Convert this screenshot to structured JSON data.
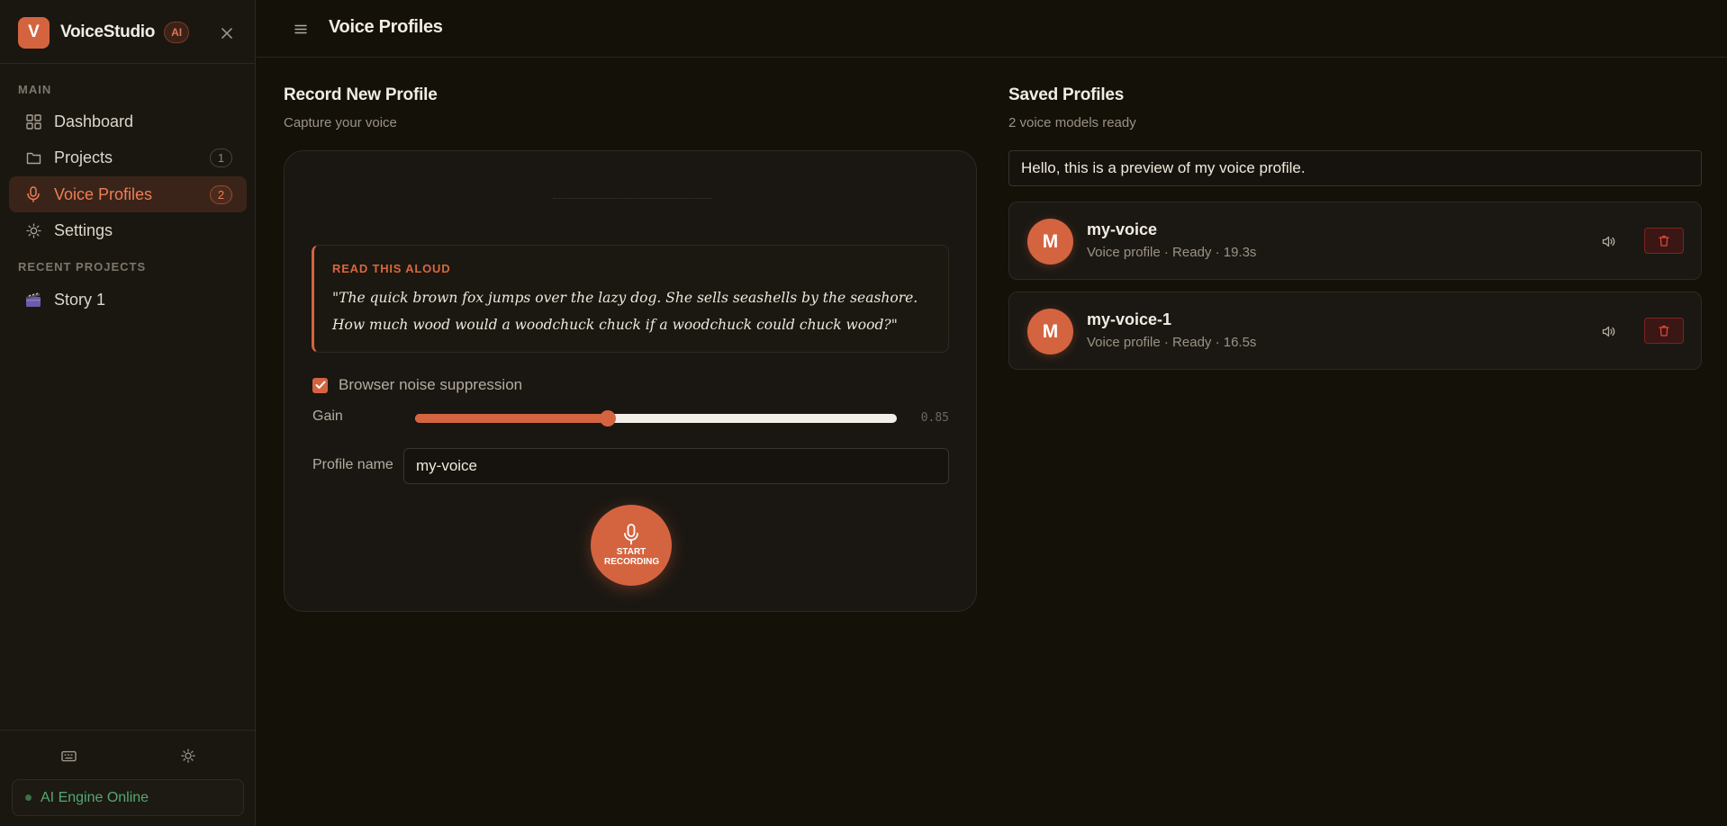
{
  "app": {
    "logo_letter": "V",
    "name": "VoiceStudio",
    "ai_badge": "AI",
    "accent_color": "#d4643f"
  },
  "sidebar": {
    "section_main": "MAIN",
    "items": [
      {
        "label": "Dashboard",
        "icon": "dashboard-grid-icon"
      },
      {
        "label": "Projects",
        "icon": "folder-icon",
        "count": "1"
      },
      {
        "label": "Voice Profiles",
        "icon": "microphone-icon",
        "count": "2",
        "active": true
      },
      {
        "label": "Settings",
        "icon": "sun-gear-icon"
      }
    ],
    "section_recent": "RECENT PROJECTS",
    "recent": [
      {
        "label": "Story 1",
        "icon": "clapperboard-icon"
      }
    ],
    "footer_icons": [
      "keyboard-icon",
      "theme-sun-icon"
    ],
    "engine_status": "AI Engine Online"
  },
  "header": {
    "title": "Voice Profiles"
  },
  "record": {
    "title": "Record New Profile",
    "subtitle": "Capture your voice",
    "prompt_label": "READ THIS ALOUD",
    "prompt_text": "\"The quick brown fox jumps over the lazy dog. She sells seashells by the seashore. How much wood would a woodchuck chuck if a woodchuck could chuck wood?\"",
    "noise_suppression_label": "Browser noise suppression",
    "noise_suppression_checked": true,
    "gain_label": "Gain",
    "gain_value": "0.85",
    "gain_fraction": 0.4,
    "profile_name_label": "Profile name",
    "profile_name_value": "my-voice",
    "record_button_label": "START RECORDING"
  },
  "saved": {
    "title": "Saved Profiles",
    "subtitle": "2 voice models ready",
    "preview_text": "Hello, this is a preview of my voice profile.",
    "profiles": [
      {
        "initial": "M",
        "name": "my-voice",
        "meta": "Voice profile · Ready · 19.3s"
      },
      {
        "initial": "M",
        "name": "my-voice-1",
        "meta": "Voice profile · Ready · 16.5s"
      }
    ]
  }
}
